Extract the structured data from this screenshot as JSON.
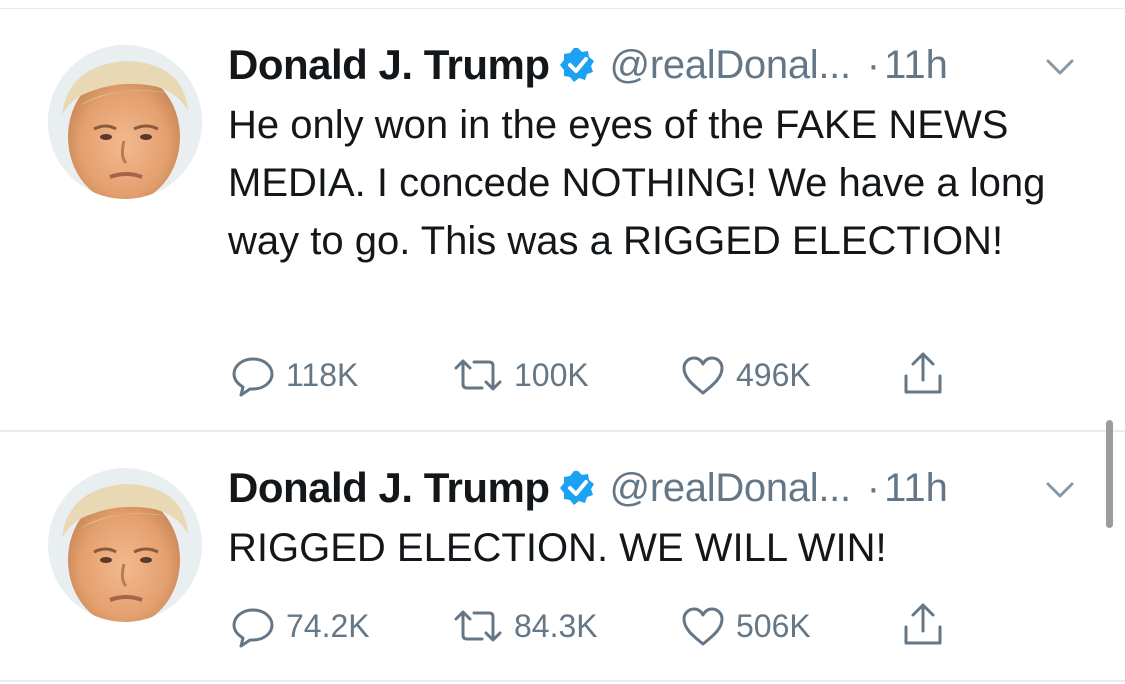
{
  "tweets": [
    {
      "display_name": "Donald J. Trump",
      "handle": "@realDonal...",
      "separator": "·",
      "time": "11h",
      "text": "He only won in the eyes of the FAKE NEWS MEDIA. I concede NOTHING! We have a long way to go. This was a RIGGED ELECTION!",
      "replies": "118K",
      "retweets": "100K",
      "likes": "496K"
    },
    {
      "display_name": "Donald J. Trump",
      "handle": "@realDonal...",
      "separator": "·",
      "time": "11h",
      "text": "RIGGED ELECTION. WE WILL WIN!",
      "replies": "74.2K",
      "retweets": "84.3K",
      "likes": "506K"
    }
  ],
  "icons": {
    "verified": "verified-badge-icon",
    "caret": "chevron-down-icon",
    "reply": "reply-icon",
    "retweet": "retweet-icon",
    "like": "heart-icon",
    "share": "share-icon"
  },
  "colors": {
    "text_primary": "#14171a",
    "text_secondary": "#657786",
    "verified_blue": "#1da1f2",
    "divider": "#e6ecf0"
  }
}
